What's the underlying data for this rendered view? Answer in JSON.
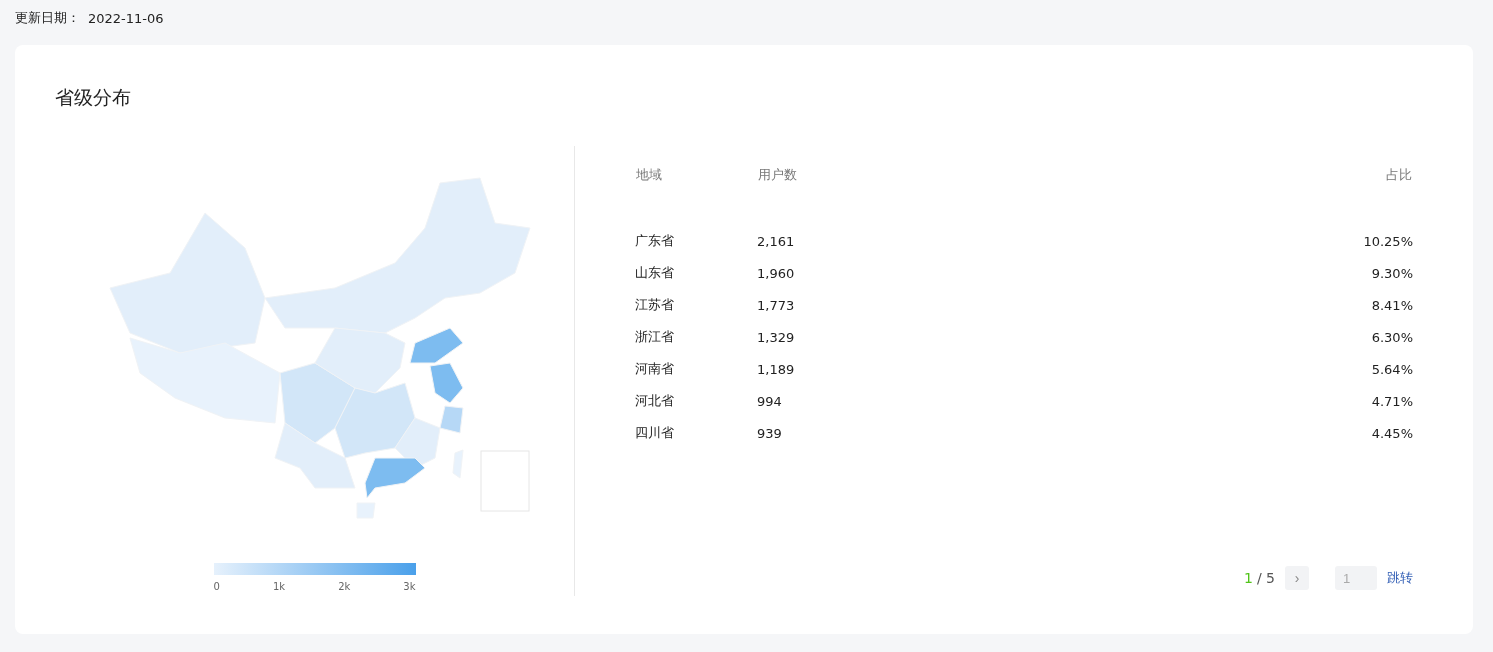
{
  "update": {
    "label": "更新日期：",
    "date": "2022-11-06"
  },
  "card": {
    "title": "省级分布",
    "legend": {
      "ticks": [
        "0",
        "1k",
        "2k",
        "3k"
      ]
    },
    "table": {
      "columns": [
        "地域",
        "用户数",
        "占比"
      ],
      "rows": [
        {
          "region": "广东省",
          "users": "2,161",
          "share": "10.25%"
        },
        {
          "region": "山东省",
          "users": "1,960",
          "share": "9.30%"
        },
        {
          "region": "江苏省",
          "users": "1,773",
          "share": "8.41%"
        },
        {
          "region": "浙江省",
          "users": "1,329",
          "share": "6.30%"
        },
        {
          "region": "河南省",
          "users": "1,189",
          "share": "5.64%"
        },
        {
          "region": "河北省",
          "users": "994",
          "share": "4.71%"
        },
        {
          "region": "四川省",
          "users": "939",
          "share": "4.45%"
        }
      ]
    },
    "pagination": {
      "current": "1",
      "total": "/ 5",
      "next": "›",
      "jump_placeholder": "1",
      "jump": "跳转"
    }
  }
}
